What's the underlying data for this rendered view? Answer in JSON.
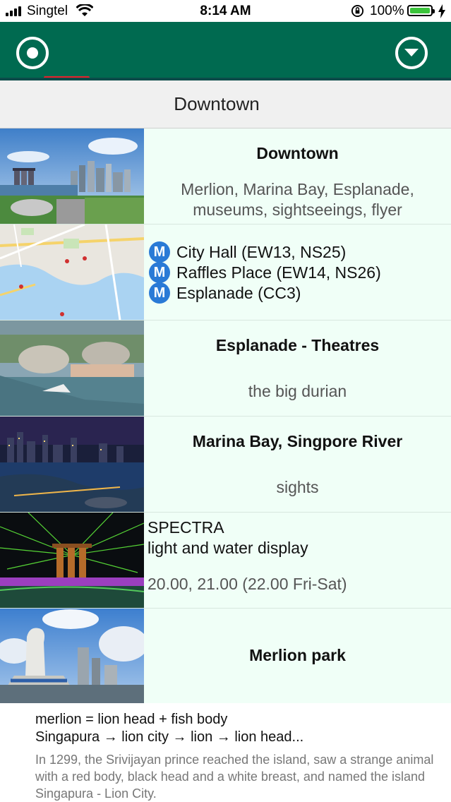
{
  "status_bar": {
    "carrier": "Singtel",
    "time": "8:14 AM",
    "battery_percent": "100%"
  },
  "navbar": {
    "left_button_icon": "location-target-icon",
    "right_button_icon": "dropdown-circle-icon",
    "brand_color": "#006a50",
    "indicator_color": "#e8212b"
  },
  "section": {
    "title": "Downtown"
  },
  "rows": [
    {
      "title": "Downtown",
      "subtitle_line1": "Merlion, Marina Bay, Esplanade,",
      "subtitle_line2": "museums, sightseeings, flyer",
      "thumbnail": "downtown-skyline-photo"
    },
    {
      "thumbnail": "map-thumbnail",
      "metro_icon": "M",
      "stations": [
        "City Hall (EW13, NS25)",
        "Raffles Place (EW14, NS26)",
        "Esplanade (CC3)"
      ]
    },
    {
      "title": "Esplanade - Theatres",
      "subtitle": "the big durian",
      "thumbnail": "esplanade-photo"
    },
    {
      "title": "Marina Bay, Singpore River",
      "subtitle": "sights",
      "thumbnail": "marina-bay-night-photo"
    },
    {
      "line1": "SPECTRA",
      "line2": "light and water display",
      "times": "20.00, 21.00 (22.00 Fri-Sat)",
      "thumbnail": "spectra-laser-show-photo"
    },
    {
      "title": "Merlion park",
      "thumbnail": "merlion-park-photo"
    }
  ],
  "description": {
    "line1": "merlion = lion head + fish body",
    "line2": "Singapura → lion city → lion → lion head...",
    "paragraph": "In 1299, the Srivijayan prince reached the island, saw a strange animal with a red body, black head and a white breast, and named the island Singapura - Lion City."
  }
}
